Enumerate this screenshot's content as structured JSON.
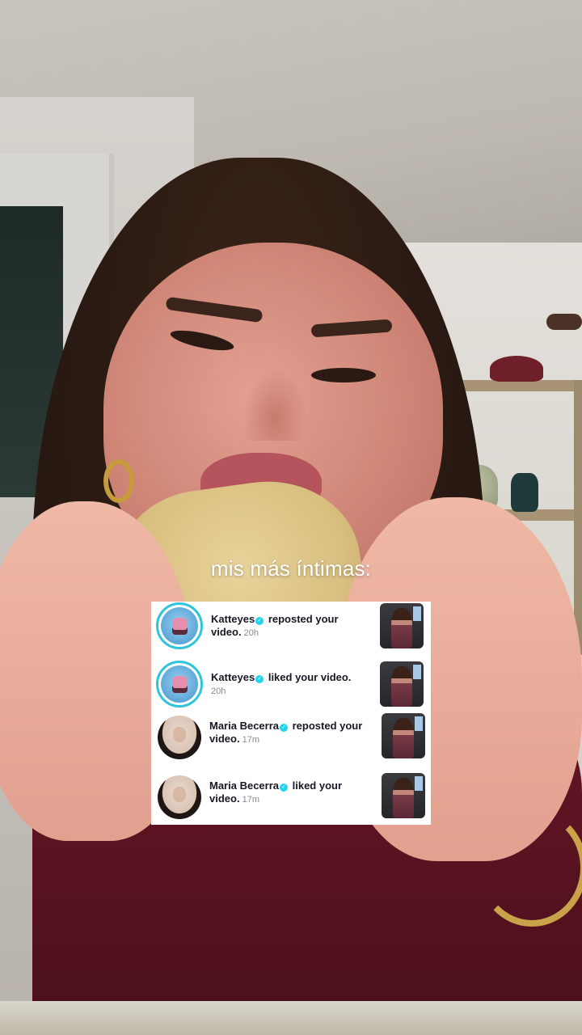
{
  "caption": "mis más íntimas:",
  "notifications": [
    {
      "username": "Katteyes",
      "verified": true,
      "action_line1": "reposted your",
      "action_line2": "video.",
      "time": "20h",
      "avatar_icon": "birthday-cake-avatar",
      "avatar_ring_color": "#2ec4d9"
    },
    {
      "username": "Katteyes",
      "verified": true,
      "action_line1": "liked your video.",
      "action_line2": "",
      "time": "20h",
      "avatar_icon": "birthday-cake-avatar",
      "avatar_ring_color": "#2ec4d9"
    },
    {
      "username": "Maria Becerra",
      "verified": true,
      "action_line1": "reposted your",
      "action_line2": "video.",
      "time": "17m",
      "avatar_icon": "portrait-avatar"
    },
    {
      "username": "Maria Becerra",
      "verified": true,
      "action_line1": "liked your",
      "action_line2": "video.",
      "time": "17m",
      "avatar_icon": "portrait-avatar"
    }
  ],
  "verified_badge_glyph": "✓",
  "colors": {
    "verified": "#20d5ec",
    "text": "#161823",
    "time": "#8a8b91"
  }
}
